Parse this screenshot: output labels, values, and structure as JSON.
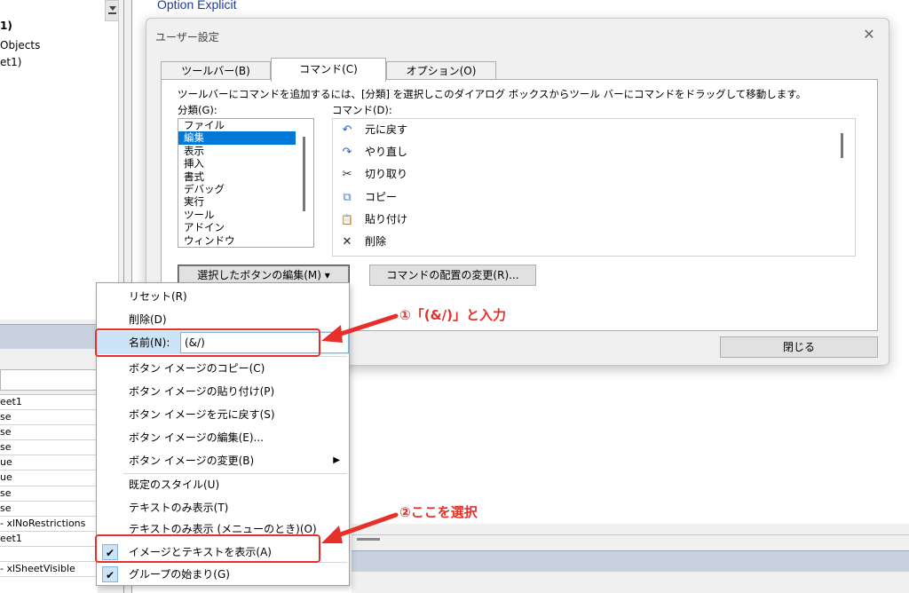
{
  "project_tree": {
    "lines": [
      "1)",
      "Objects",
      "et1)"
    ]
  },
  "properties": {
    "rows": [
      "eet1",
      "se",
      "se",
      "se",
      "ue",
      "ue",
      "se",
      "se",
      "- xlNoRestrictions",
      "eet1",
      "",
      "- xlSheetVisible"
    ]
  },
  "code": {
    "line": "Option Explicit"
  },
  "dialog": {
    "title": "ユーザー設定",
    "close_glyph": "✕",
    "tabs": [
      "ツールバー(B)",
      "コマンド(C)",
      "オプション(O)"
    ],
    "instruction": "ツールバーにコマンドを追加するには、[分類] を選択しこのダイアログ ボックスからツール バーにコマンドをドラッグして移動します。",
    "category_label": "分類(G):",
    "command_label": "コマンド(D):",
    "categories": [
      "ファイル",
      "編集",
      "表示",
      "挿入",
      "書式",
      "デバッグ",
      "実行",
      "ツール",
      "アドイン",
      "ウィンドウ"
    ],
    "selected_category": "編集",
    "commands": [
      {
        "icon": "undo-icon",
        "glyph": "↶",
        "label": "元に戻す"
      },
      {
        "icon": "redo-icon",
        "glyph": "↷",
        "label": "やり直し"
      },
      {
        "icon": "scissors-icon",
        "glyph": "✂",
        "label": "切り取り"
      },
      {
        "icon": "copy-icon",
        "glyph": "⧉",
        "label": "コピー"
      },
      {
        "icon": "paste-icon",
        "glyph": "📋",
        "label": "貼り付け"
      },
      {
        "icon": "delete-icon",
        "glyph": "✕",
        "label": "削除"
      }
    ],
    "edit_selected_button": "選択したボタンの編集(M) ▾",
    "rearrange_button": "コマンドの配置の変更(R)...",
    "close_button": "閉じる"
  },
  "context_menu": {
    "reset": "リセット(R)",
    "delete": "削除(D)",
    "name_label": "名前(N):",
    "name_value": "(&/)",
    "copy_image": "ボタン イメージのコピー(C)",
    "paste_image": "ボタン イメージの貼り付け(P)",
    "reset_image": "ボタン イメージを元に戻す(S)",
    "edit_image": "ボタン イメージの編集(E)...",
    "change_image": "ボタン イメージの変更(B)",
    "default_style": "既定のスタイル(U)",
    "text_only": "テキストのみ表示(T)",
    "text_only_menu": "テキストのみ表示 (メニューのとき)(O)",
    "image_and_text": "イメージとテキストを表示(A)",
    "begin_group": "グループの始まり(G)"
  },
  "annotations": {
    "callout_1": "①「(&/)」と入力",
    "callout_2": "②ここを選択",
    "color": "#e8302a"
  }
}
